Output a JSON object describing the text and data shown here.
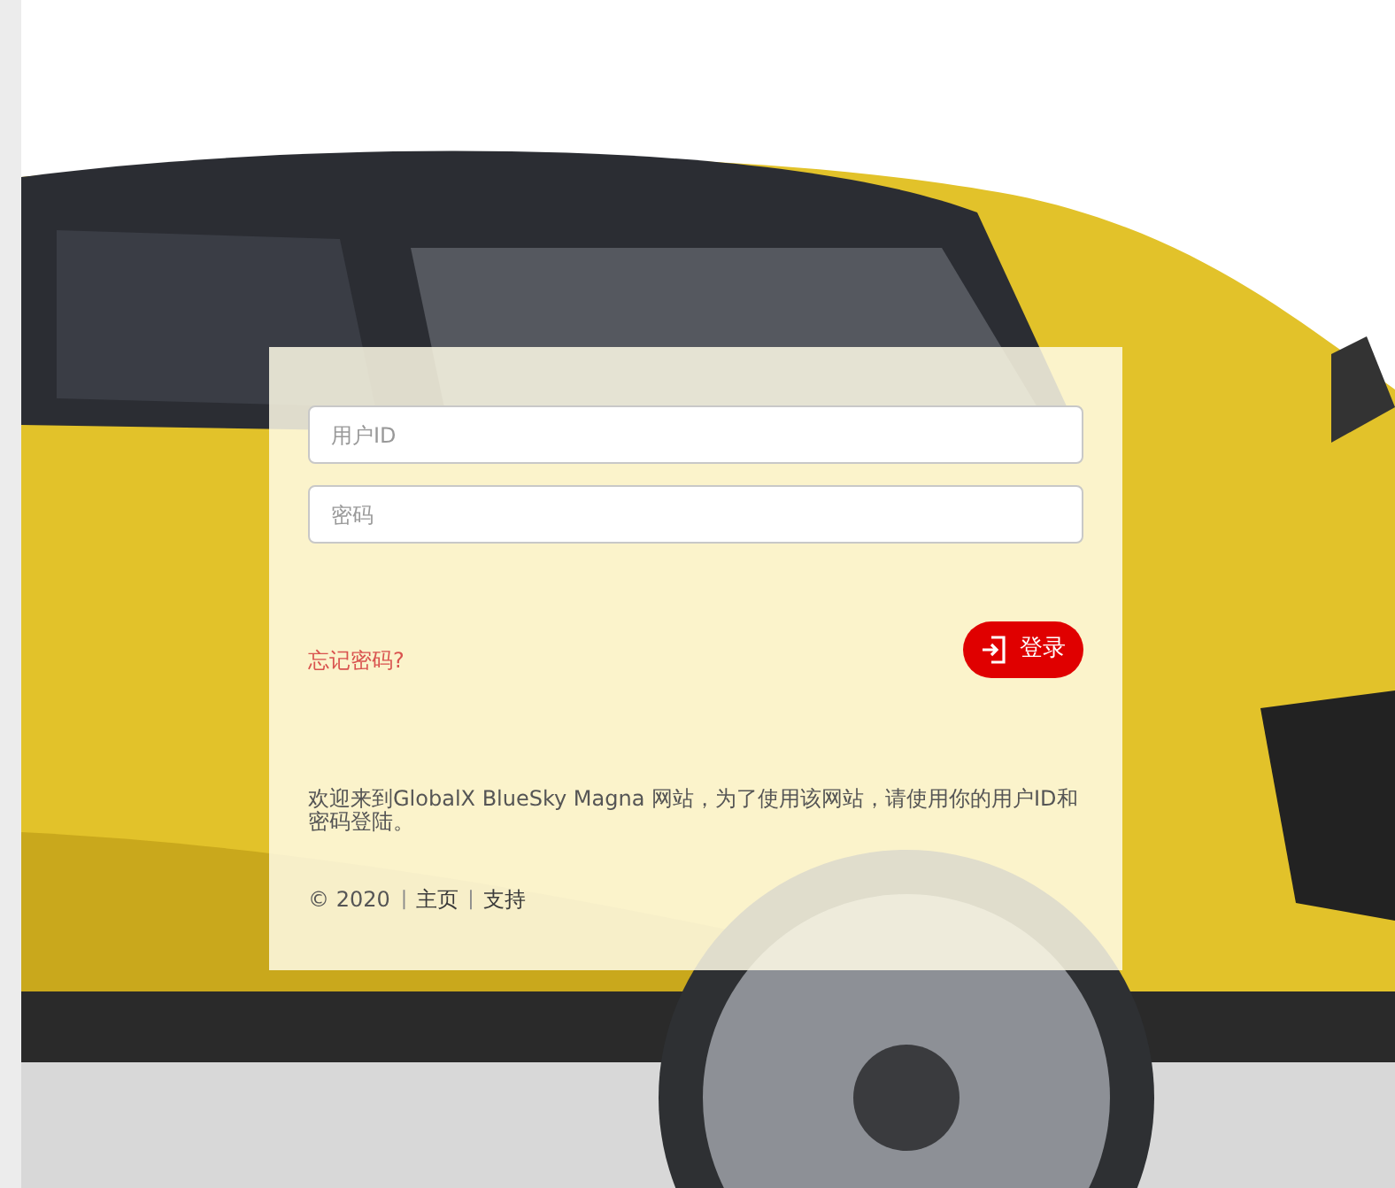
{
  "login": {
    "user_field": {
      "placeholder": "用户ID"
    },
    "password_field": {
      "placeholder": "密码"
    },
    "forgot_link": "忘记密码?",
    "login_button": "登录",
    "welcome": "欢迎来到GlobalX BlueSky Magna 网站，为了使用该网站，请使用你的用户ID和密码登陆。",
    "footer": [
      {
        "kind": "text",
        "text": "© 2020"
      },
      {
        "kind": "separator",
        "text": "|"
      },
      {
        "kind": "link",
        "text": "主页"
      },
      {
        "kind": "separator",
        "text": "|"
      },
      {
        "kind": "link",
        "text": "支持"
      }
    ]
  }
}
